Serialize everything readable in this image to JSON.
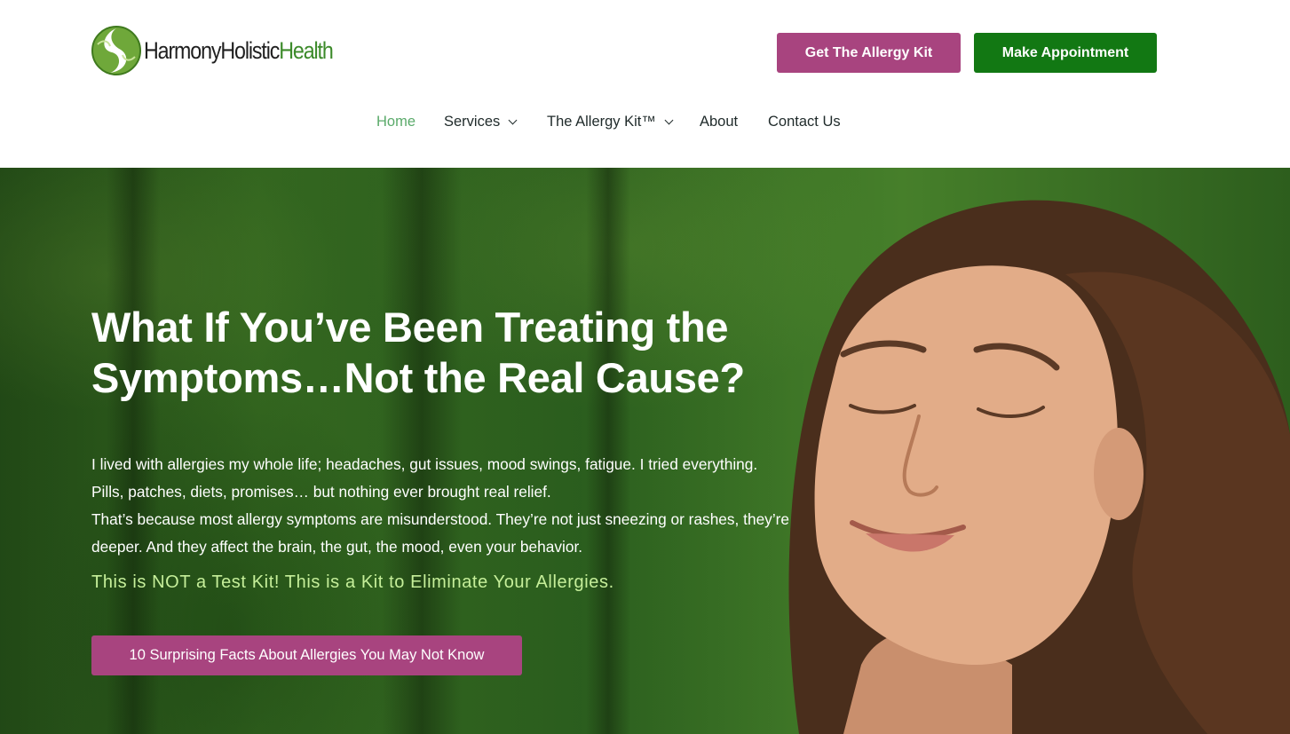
{
  "header": {
    "logo": {
      "icon": "leaf-s-logo",
      "name_part1": "Harmony",
      "name_part2": "Holistic",
      "name_part3": "Health"
    },
    "buttons": {
      "allergy_kit": "Get The Allergy Kit",
      "appointment": "Make Appointment"
    },
    "colors": {
      "plum": "#a8447f",
      "green": "#127813",
      "nav_active": "#5aaa6a"
    }
  },
  "nav": {
    "items": [
      {
        "label": "Home",
        "active": true
      },
      {
        "label": "Services",
        "has_dropdown": true
      },
      {
        "label": "The Allergy Kit™",
        "has_dropdown": true
      },
      {
        "label": "About"
      },
      {
        "label": "Contact Us"
      }
    ]
  },
  "hero": {
    "title_line1": "What If You’ve Been Treating the",
    "title_line2": "Symptoms…Not the Real Cause?",
    "paragraph1": "I lived with allergies my whole life; headaches, gut issues, mood swings, fatigue. I tried everything. Pills, patches, diets, promises… but nothing ever brought real relief.",
    "paragraph2": "That’s because most allergy symptoms are misunderstood. They’re not just sneezing or rashes, they’re deeper. And they affect the brain, the gut, the mood, even your behavior.",
    "tagline": "This is NOT a Test Kit! This is a Kit to Eliminate Your Allergies.",
    "cta": "10 Surprising Facts About Allergies You May Not Know",
    "image": "woman-eyes-closed-forest-photo"
  }
}
